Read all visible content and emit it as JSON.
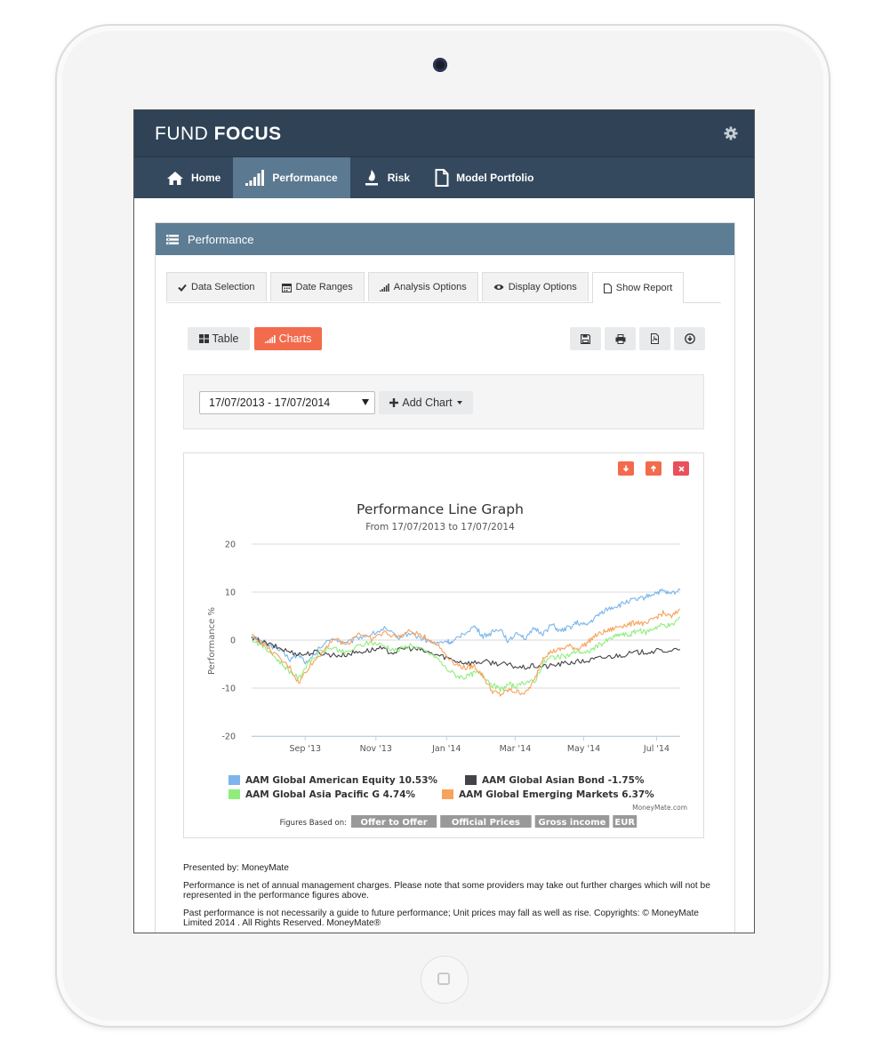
{
  "app": {
    "brand_light": "FUND",
    "brand_bold": "FOCUS"
  },
  "nav": {
    "home": "Home",
    "performance": "Performance",
    "risk": "Risk",
    "model_portfolio": "Model Portfolio"
  },
  "panel": {
    "title": "Performance"
  },
  "tabs": {
    "data_selection": "Data Selection",
    "date_ranges": "Date Ranges",
    "analysis_options": "Analysis Options",
    "display_options": "Display Options",
    "show_report": "Show Report"
  },
  "view_buttons": {
    "table": "Table",
    "charts": "Charts"
  },
  "date_select": {
    "value": "17/07/2013 - 17/07/2014"
  },
  "add_chart": {
    "label": "Add Chart"
  },
  "chart_data": {
    "type": "line",
    "title": "Performance Line Graph",
    "subtitle": "From 17/07/2013 to 17/07/2014",
    "ylabel": "Performance %",
    "xlabel": "",
    "ylim": [
      -20,
      20
    ],
    "yticks": [
      20,
      10,
      0,
      -10,
      -20
    ],
    "xticks": [
      {
        "label": "Sep '13",
        "t": 0.125
      },
      {
        "label": "Nov '13",
        "t": 0.29
      },
      {
        "label": "Jan '14",
        "t": 0.455
      },
      {
        "label": "Mar '14",
        "t": 0.615
      },
      {
        "label": "May '14",
        "t": 0.775
      },
      {
        "label": "Jul '14",
        "t": 0.945
      }
    ],
    "grid": true,
    "legend_position": "bottom",
    "credit": "MoneyMate.com",
    "series": [
      {
        "name": "AAM Global American Equity 10.53%",
        "color": "#7cb5ec",
        "points": [
          [
            0,
            0.8
          ],
          [
            0.03,
            -0.5
          ],
          [
            0.06,
            -1.8
          ],
          [
            0.09,
            -4
          ],
          [
            0.11,
            -3
          ],
          [
            0.13,
            -5
          ],
          [
            0.16,
            -1.5
          ],
          [
            0.19,
            0.5
          ],
          [
            0.22,
            -0.8
          ],
          [
            0.25,
            0.6
          ],
          [
            0.28,
            1.2
          ],
          [
            0.31,
            2.4
          ],
          [
            0.34,
            0.5
          ],
          [
            0.37,
            1.5
          ],
          [
            0.4,
            0.2
          ],
          [
            0.43,
            -0.8
          ],
          [
            0.455,
            -0.2
          ],
          [
            0.47,
            -0.6
          ],
          [
            0.49,
            1.2
          ],
          [
            0.52,
            2.8
          ],
          [
            0.54,
            0.8
          ],
          [
            0.56,
            1.5
          ],
          [
            0.58,
            2.5
          ],
          [
            0.6,
            -0.4
          ],
          [
            0.62,
            1.8
          ],
          [
            0.64,
            0.2
          ],
          [
            0.66,
            2.4
          ],
          [
            0.68,
            1.4
          ],
          [
            0.7,
            3.2
          ],
          [
            0.72,
            1.8
          ],
          [
            0.74,
            2.6
          ],
          [
            0.76,
            3.6
          ],
          [
            0.78,
            3
          ],
          [
            0.8,
            4.5
          ],
          [
            0.82,
            6
          ],
          [
            0.84,
            6.8
          ],
          [
            0.86,
            7.3
          ],
          [
            0.88,
            8.2
          ],
          [
            0.9,
            8.4
          ],
          [
            0.92,
            9
          ],
          [
            0.94,
            9.8
          ],
          [
            0.96,
            10.2
          ],
          [
            0.975,
            9.6
          ],
          [
            1,
            10.4
          ]
        ]
      },
      {
        "name": "AAM Global Asian Bond -1.75%",
        "color": "#434348",
        "points": [
          [
            0,
            0.3
          ],
          [
            0.03,
            -0.6
          ],
          [
            0.06,
            -1.5
          ],
          [
            0.09,
            -2.5
          ],
          [
            0.12,
            -3
          ],
          [
            0.15,
            -2.5
          ],
          [
            0.18,
            -3
          ],
          [
            0.21,
            -3.2
          ],
          [
            0.24,
            -2.6
          ],
          [
            0.27,
            -2.2
          ],
          [
            0.3,
            -1.8
          ],
          [
            0.33,
            -2.6
          ],
          [
            0.36,
            -1.6
          ],
          [
            0.39,
            -2
          ],
          [
            0.42,
            -2.8
          ],
          [
            0.45,
            -3.5
          ],
          [
            0.48,
            -4.4
          ],
          [
            0.51,
            -4.8
          ],
          [
            0.54,
            -4.5
          ],
          [
            0.57,
            -4.8
          ],
          [
            0.6,
            -5.2
          ],
          [
            0.63,
            -5.8
          ],
          [
            0.66,
            -5.4
          ],
          [
            0.69,
            -5.5
          ],
          [
            0.72,
            -5
          ],
          [
            0.75,
            -4.6
          ],
          [
            0.78,
            -4.4
          ],
          [
            0.81,
            -3.8
          ],
          [
            0.84,
            -3.4
          ],
          [
            0.87,
            -3
          ],
          [
            0.9,
            -2.6
          ],
          [
            0.93,
            -2.4
          ],
          [
            0.96,
            -2.2
          ],
          [
            1,
            -2
          ]
        ]
      },
      {
        "name": "AAM Global Asia Pacific G 4.74%",
        "color": "#90ed7d",
        "points": [
          [
            0,
            0.3
          ],
          [
            0.03,
            -1.5
          ],
          [
            0.06,
            -4
          ],
          [
            0.085,
            -6.2
          ],
          [
            0.11,
            -8
          ],
          [
            0.13,
            -5
          ],
          [
            0.16,
            -2.5
          ],
          [
            0.19,
            -1.5
          ],
          [
            0.22,
            -2.8
          ],
          [
            0.25,
            -1.2
          ],
          [
            0.28,
            -0.5
          ],
          [
            0.31,
            -1.2
          ],
          [
            0.34,
            -2.2
          ],
          [
            0.37,
            -1
          ],
          [
            0.4,
            -2.2
          ],
          [
            0.43,
            -3.5
          ],
          [
            0.455,
            -6
          ],
          [
            0.48,
            -7.5
          ],
          [
            0.5,
            -7.8
          ],
          [
            0.52,
            -6.8
          ],
          [
            0.54,
            -7.2
          ],
          [
            0.56,
            -9.2
          ],
          [
            0.58,
            -10.4
          ],
          [
            0.6,
            -9.2
          ],
          [
            0.62,
            -9.8
          ],
          [
            0.64,
            -8.6
          ],
          [
            0.66,
            -8.8
          ],
          [
            0.68,
            -4.8
          ],
          [
            0.7,
            -3.5
          ],
          [
            0.72,
            -3.6
          ],
          [
            0.74,
            -3.2
          ],
          [
            0.76,
            -2.2
          ],
          [
            0.78,
            -2.8
          ],
          [
            0.8,
            -1.6
          ],
          [
            0.82,
            -0.6
          ],
          [
            0.84,
            0.4
          ],
          [
            0.86,
            1.2
          ],
          [
            0.88,
            1
          ],
          [
            0.9,
            2
          ],
          [
            0.92,
            1.6
          ],
          [
            0.94,
            2.6
          ],
          [
            0.96,
            3.2
          ],
          [
            0.98,
            3
          ],
          [
            1,
            4.8
          ]
        ]
      },
      {
        "name": "AAM Global Emerging Markets 6.37%",
        "color": "#f7a35c",
        "points": [
          [
            0,
            1
          ],
          [
            0.03,
            -1
          ],
          [
            0.06,
            -3.5
          ],
          [
            0.09,
            -5.8
          ],
          [
            0.11,
            -9
          ],
          [
            0.13,
            -6
          ],
          [
            0.16,
            -3
          ],
          [
            0.19,
            0.4
          ],
          [
            0.22,
            -1
          ],
          [
            0.25,
            1.5
          ],
          [
            0.28,
            0.2
          ],
          [
            0.31,
            1.6
          ],
          [
            0.34,
            0.6
          ],
          [
            0.37,
            1.8
          ],
          [
            0.4,
            0.8
          ],
          [
            0.43,
            -0.6
          ],
          [
            0.455,
            -3.2
          ],
          [
            0.48,
            -5.2
          ],
          [
            0.5,
            -5.8
          ],
          [
            0.52,
            -5.4
          ],
          [
            0.54,
            -7.5
          ],
          [
            0.56,
            -10.5
          ],
          [
            0.58,
            -11.4
          ],
          [
            0.6,
            -10.4
          ],
          [
            0.62,
            -10.8
          ],
          [
            0.64,
            -11
          ],
          [
            0.66,
            -8.4
          ],
          [
            0.68,
            -3.5
          ],
          [
            0.7,
            -2.4
          ],
          [
            0.72,
            -2
          ],
          [
            0.74,
            -1.2
          ],
          [
            0.76,
            -1.8
          ],
          [
            0.78,
            -0.8
          ],
          [
            0.8,
            0.8
          ],
          [
            0.82,
            1.6
          ],
          [
            0.84,
            2.2
          ],
          [
            0.86,
            3
          ],
          [
            0.88,
            3.2
          ],
          [
            0.9,
            3.8
          ],
          [
            0.92,
            3.2
          ],
          [
            0.94,
            4.6
          ],
          [
            0.96,
            5.6
          ],
          [
            0.98,
            4.8
          ],
          [
            1,
            6.5
          ]
        ]
      }
    ]
  },
  "figures_based_on": {
    "label": "Figures Based on:",
    "badges": [
      "Offer to Offer",
      "Official Prices",
      "Gross income",
      "EUR"
    ]
  },
  "footnotes": {
    "presented_by": "Presented by: MoneyMate",
    "performance_note": "Performance is net of annual management charges. Please note that some providers may take out further charges which will not be represented in the performance figures above.",
    "past_performance": "Past performance is not necessarily a guide to future performance; Unit prices may fall as well as rise. Copyrights: © MoneyMate Limited 2014 . All Rights Reserved. MoneyMate®"
  },
  "colors": {
    "topbar": "#2f4256",
    "nav": "#34495e",
    "nav_active": "#5b7990",
    "panel_head": "#5d7d94",
    "accent": "#f26b4c",
    "danger": "#e8505b"
  }
}
